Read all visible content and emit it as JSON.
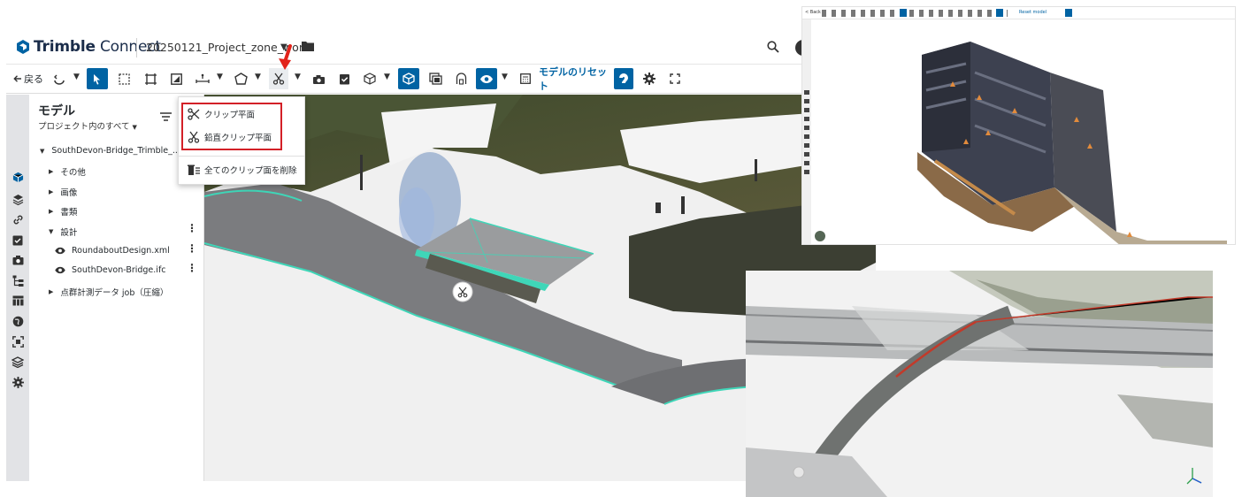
{
  "header": {
    "brand_bold": "Trimble",
    "brand_light": " Connect",
    "project_name": "20250121_Project_zone_world"
  },
  "toolbar": {
    "back_label": "戻る",
    "reset_model_label": "モデルのリセット"
  },
  "panel": {
    "title": "モデル",
    "scope_label": "プロジェクト内のすべて",
    "tree": [
      {
        "label": "SouthDevon-Bridge_Trimble_...",
        "expanded": true
      },
      {
        "label": "その他",
        "expanded": false
      },
      {
        "label": "画像",
        "expanded": false
      },
      {
        "label": "書類",
        "expanded": false
      },
      {
        "label": "設計",
        "expanded": true
      },
      {
        "label": "RoundaboutDesign.xml",
        "visible": true
      },
      {
        "label": "SouthDevon-Bridge.ifc",
        "visible": true
      },
      {
        "label": "点群計測データ job（圧縮）",
        "expanded": false
      }
    ]
  },
  "clip_menu": {
    "items": [
      {
        "label": "クリップ平面",
        "icon": "scissors-icon"
      },
      {
        "label": "鉛直クリップ平面",
        "icon": "vertical-scissors-icon"
      },
      {
        "label": "全てのクリップ面を削除",
        "icon": "trash-list-icon"
      }
    ]
  },
  "overview": {
    "toolbar_back": "< Back",
    "toolbar_reset": "Reset model"
  },
  "colors": {
    "accent": "#0063a3",
    "highlight_box": "#d32027",
    "pointer_arrow": "#e2231a",
    "model_edge": "#3fd6b8"
  }
}
